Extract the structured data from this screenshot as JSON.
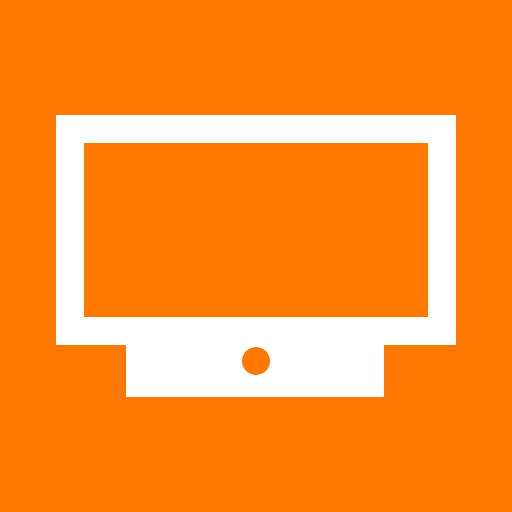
{
  "app_icon": {
    "icon": "tv-icon",
    "colors": {
      "background": "#ff7900",
      "foreground": "#ffffff"
    }
  }
}
